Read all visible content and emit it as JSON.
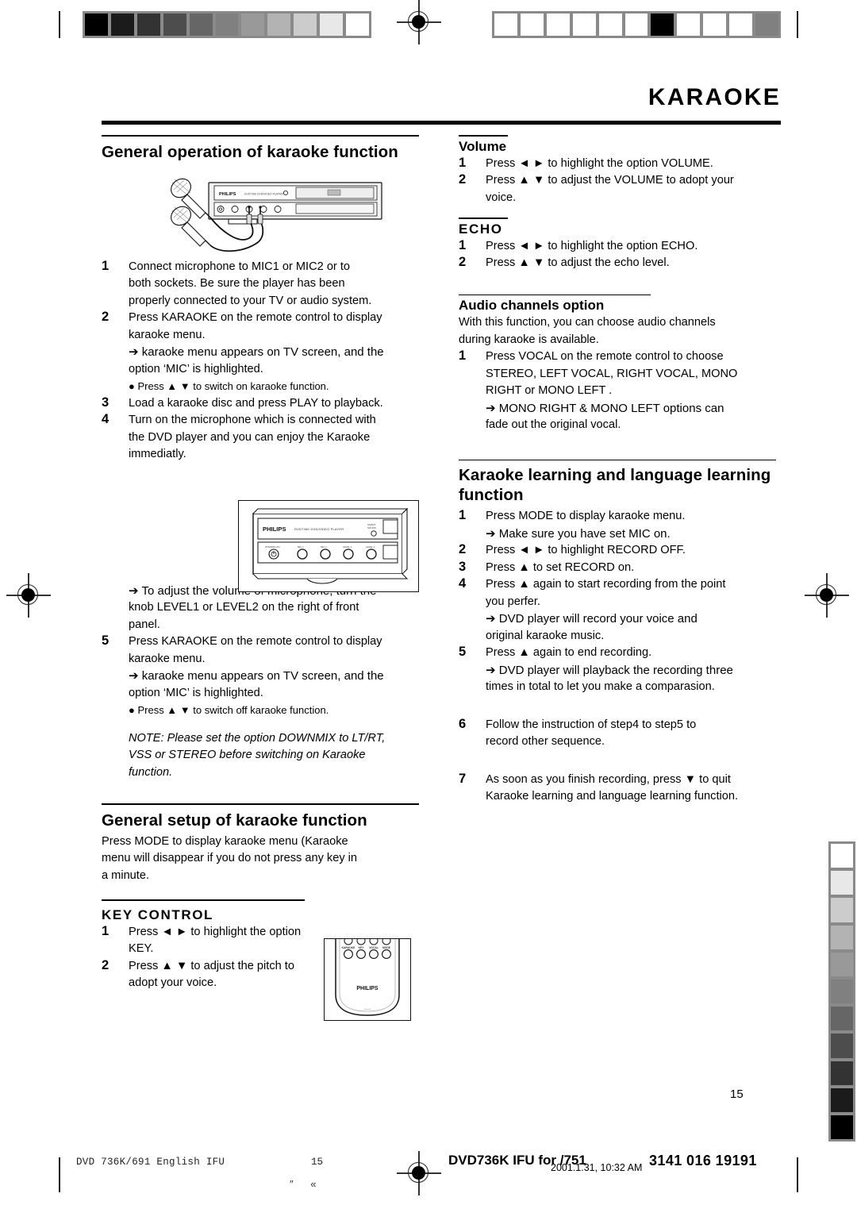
{
  "header": {
    "title": "KARAOKE"
  },
  "left_column": {
    "section1": {
      "heading": "General operation of karaoke function",
      "steps": [
        {
          "num": "1",
          "lines": [
            "Connect microphone to MIC1 or MIC2 or to",
            "both sockets. Be sure the player has been",
            "properly connected to your TV or audio system."
          ]
        },
        {
          "num": "2",
          "lines": [
            "Press KARAOKE on the remote control to display",
            "karaoke menu."
          ],
          "arrow": [
            "➔ karaoke menu appears on TV screen, and the",
            "option ‘MIC’ is highlighted."
          ],
          "bullet": [
            "●    Press ▲ ▼ to switch on karaoke function."
          ]
        },
        {
          "num": "3",
          "lines": [
            "Load a karaoke disc and press PLAY to playback."
          ]
        },
        {
          "num": "4",
          "lines": [
            "Turn on the microphone which is connected with",
            "the DVD player and you can enjoy the Karaoke",
            "immediatly."
          ]
        }
      ],
      "after_panel_arrow": [
        "➔ To adjust the volume of microphone, turn the",
        "knob LEVEL1 or LEVEL2 on the right of front",
        "panel."
      ],
      "step5": {
        "num": "5",
        "lines": [
          "Press KARAOKE on the remote control to display",
          "karaoke menu."
        ],
        "arrow": [
          "➔ karaoke menu appears on TV screen, and the",
          "option ‘MIC’ is highlighted."
        ],
        "bullet": [
          "●    Press ▲ ▼ to switch off karaoke function."
        ]
      },
      "note": [
        "NOTE: Please set the option DOWNMIX to LT/RT,",
        "VSS or STEREO before switching on Karaoke",
        "function."
      ]
    },
    "section2": {
      "heading": "General setup of karaoke function",
      "intro": [
        "Press MODE to display karaoke menu (Karaoke",
        "menu will disappear if you do not press any key in",
        "a minute."
      ],
      "sub": {
        "heading": "KEY CONTROL",
        "steps": [
          {
            "num": "1",
            "lines": [
              "Press ◄ ► to highlight the option",
              "KEY."
            ]
          },
          {
            "num": "2",
            "lines": [
              "Press ▲ ▼ to adjust the pitch to",
              "adopt your voice."
            ]
          }
        ]
      }
    }
  },
  "right_column": {
    "volume": {
      "heading": "Volume",
      "steps": [
        {
          "num": "1",
          "lines": [
            "Press ◄ ► to highlight the option VOLUME."
          ]
        },
        {
          "num": "2",
          "lines": [
            "Press ▲ ▼ to adjust the VOLUME to adopt your",
            "voice."
          ]
        }
      ]
    },
    "echo": {
      "heading": "ECHO",
      "steps": [
        {
          "num": "1",
          "lines": [
            "Press ◄ ► to highlight the option ECHO."
          ]
        },
        {
          "num": "2",
          "lines": [
            "Press ▲ ▼ to adjust the echo level."
          ]
        }
      ]
    },
    "audio_channels": {
      "heading": "Audio channels option",
      "intro": [
        "With this function, you can choose audio channels",
        "during karaoke is available."
      ],
      "steps": [
        {
          "num": "1",
          "lines": [
            "Press VOCAL on the remote control to choose",
            "STEREO, LEFT  VOCAL, RIGHT VOCAL, MONO",
            "RIGHT or MONO LEFT ."
          ],
          "arrow": [
            "➔  MONO RIGHT & MONO LEFT options can",
            "fade out the original vocal."
          ]
        }
      ]
    },
    "learning": {
      "heading": "Karaoke learning and language learning function",
      "steps": [
        {
          "num": "1",
          "lines": [
            "Press MODE to display karaoke menu."
          ],
          "arrow": [
            "➔  Make sure you have set MIC on."
          ]
        },
        {
          "num": "2",
          "lines": [
            "Press ◄ ► to highlight RECORD OFF."
          ]
        },
        {
          "num": "3",
          "lines": [
            "Press ▲ to set RECORD on."
          ]
        },
        {
          "num": "4",
          "lines": [
            "Press ▲ again to start recording from the point",
            "you perfer."
          ],
          "arrow": [
            "➔ DVD player will record your voice and",
            "original karaoke music."
          ]
        },
        {
          "num": "5",
          "lines": [
            "Press ▲ again to end recording."
          ],
          "arrow": [
            "➔ DVD player will playback the recording three",
            "times in total to let you make a comparasion."
          ]
        },
        {
          "num": "6",
          "lines": [
            "Follow the instruction of step4 to step5 to",
            "record other sequence."
          ]
        },
        {
          "num": "7",
          "lines": [
            "As soon as you finish recording, press ▼  to quit",
            "Karaoke learning and language learning function."
          ]
        }
      ]
    }
  },
  "figures": {
    "mic_player": {
      "brand": "PHILIPS",
      "model": "DVD736K  DVD/VIDEO PLAYER"
    },
    "front_panel": {
      "brand": "PHILIPS",
      "model": "DVD736K  DVD/VIDEO PLAYER",
      "standby_label": "STANDBY-ON",
      "smart_label": "SMART SOUND",
      "knob_labels": [
        "MIC 1",
        "MIC 2",
        "LEVEL 1",
        "LEVEL 2"
      ]
    },
    "remote": {
      "brand": "PHILIPS",
      "button_labels": [
        "KARAOKE",
        "KEY",
        "VOCAL",
        "MODE"
      ]
    }
  },
  "footer": {
    "page_number": "15",
    "left_text": "DVD 736K/691 English IFU",
    "left_page": "15",
    "marks": "″ «",
    "doc_id": "DVD736K IFU for /751",
    "timestamp": "2001.1.31, 10:32 AM",
    "code": "3141 016 19191"
  },
  "calibration": {
    "top_left_steps": [
      "#000000",
      "#1b1b1b",
      "#333333",
      "#4d4d4d",
      "#666666",
      "#808080",
      "#999999",
      "#b3b3b3",
      "#cccccc",
      "#e8e8e8",
      "#ffffff"
    ],
    "top_right_steps": [
      "#ffffff",
      "#ffffff",
      "#ffffff",
      "#ffffff",
      "#ffffff",
      "#ffffff",
      "#000000",
      "#ffffff",
      "#ffffff",
      "#ffffff",
      "#808080"
    ],
    "right_vertical_steps": [
      "#ffffff",
      "#e8e8e8",
      "#cccccc",
      "#b3b3b3",
      "#999999",
      "#808080",
      "#666666",
      "#4d4d4d",
      "#333333",
      "#1b1b1b",
      "#000000"
    ]
  }
}
